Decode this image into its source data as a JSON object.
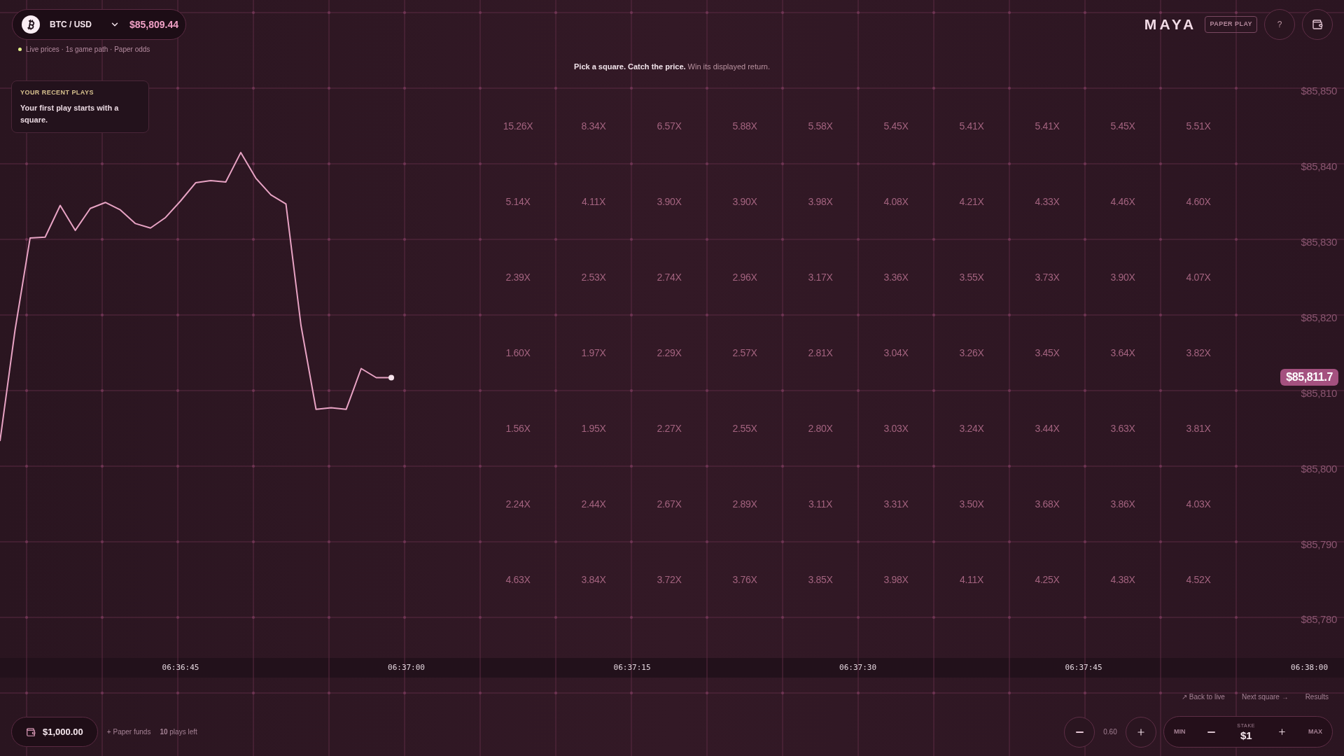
{
  "header": {
    "pair": "BTC / USD",
    "price": "$85,809.44",
    "status": "Live prices · 1s game path · Paper odds"
  },
  "recent_plays": {
    "title": "YOUR RECENT PLAYS",
    "message": "Your first play starts with a square."
  },
  "hint": "**Pick a square. Catch the price.** Win its displayed return.",
  "brand": {
    "name": "MAYA",
    "badge": "PAPER PLAY",
    "help": "?"
  },
  "chart_data": {
    "type": "line",
    "x": [
      23793,
      23794,
      23795,
      23796,
      23797,
      23798,
      23799,
      23800,
      23801,
      23802,
      23803,
      23804,
      23805,
      23806,
      23807,
      23808,
      23809,
      23810,
      23811,
      23812,
      23813,
      23814,
      23815,
      23816,
      23817,
      23818,
      23819
    ],
    "series": [
      {
        "color": "#e8a3c4",
        "values": [
          85803.3,
          85818.0,
          85830.2,
          85830.3,
          85834.5,
          85831.2,
          85834.1,
          85834.9,
          85833.9,
          85832.1,
          85831.5,
          85832.9,
          85835.1,
          85837.5,
          85837.8,
          85837.6,
          85841.5,
          85838.1,
          85835.9,
          85834.7,
          85818.6,
          85807.5,
          85807.7,
          85807.5,
          85812.9,
          85811.7,
          85811.7
        ]
      }
    ],
    "xlim": [
      23793,
      23882.3
    ],
    "ylim": [
      85761.6,
      85861.7
    ],
    "grid": true,
    "xticks": [
      {
        "value": 23805,
        "label": "06:36:45"
      },
      {
        "value": 23820,
        "label": "06:37:00"
      },
      {
        "value": 23835,
        "label": "06:37:15"
      },
      {
        "value": 23850,
        "label": "06:37:30"
      },
      {
        "value": 23865,
        "label": "06:37:45"
      },
      {
        "value": 23880,
        "label": "06:38:00"
      }
    ],
    "yticks": [
      {
        "value": 85850,
        "label": "$85,850"
      },
      {
        "value": 85840,
        "label": "$85,840"
      },
      {
        "value": 85830,
        "label": "$85,830"
      },
      {
        "value": 85820,
        "label": "$85,820"
      },
      {
        "value": 85810,
        "label": "$85,810"
      },
      {
        "value": 85800,
        "label": "$85,800"
      },
      {
        "value": 85790,
        "label": "$85,790"
      },
      {
        "value": 85780,
        "label": "$85,780"
      }
    ]
  },
  "current_price": "$85,811.7",
  "multipliers": [
    [
      "15.26X",
      "8.34X",
      "6.57X",
      "5.88X",
      "5.58X",
      "5.45X",
      "5.41X",
      "5.41X",
      "5.45X",
      "5.51X"
    ],
    [
      "5.14X",
      "4.11X",
      "3.90X",
      "3.90X",
      "3.98X",
      "4.08X",
      "4.21X",
      "4.33X",
      "4.46X",
      "4.60X"
    ],
    [
      "2.39X",
      "2.53X",
      "2.74X",
      "2.96X",
      "3.17X",
      "3.36X",
      "3.55X",
      "3.73X",
      "3.90X",
      "4.07X"
    ],
    [
      "1.60X",
      "1.97X",
      "2.29X",
      "2.57X",
      "2.81X",
      "3.04X",
      "3.26X",
      "3.45X",
      "3.64X",
      "3.82X"
    ],
    [
      "1.56X",
      "1.95X",
      "2.27X",
      "2.55X",
      "2.80X",
      "3.03X",
      "3.24X",
      "3.44X",
      "3.63X",
      "3.81X"
    ],
    [
      "2.24X",
      "2.44X",
      "2.67X",
      "2.89X",
      "3.11X",
      "3.31X",
      "3.50X",
      "3.68X",
      "3.86X",
      "4.03X"
    ],
    [
      "4.63X",
      "3.84X",
      "3.72X",
      "3.76X",
      "3.85X",
      "3.98X",
      "4.11X",
      "4.25X",
      "4.38X",
      "4.52X"
    ]
  ],
  "footer": {
    "links": [
      "↗ Back to live",
      "Next square →",
      "Results"
    ],
    "balance": "$1,000.00",
    "paper_funds": "+ Paper funds",
    "plays_left": "**10** plays left",
    "odds": "0.60",
    "stake": {
      "min": "MIN",
      "label": "STAKE",
      "value": "$1",
      "max": "MAX"
    }
  }
}
